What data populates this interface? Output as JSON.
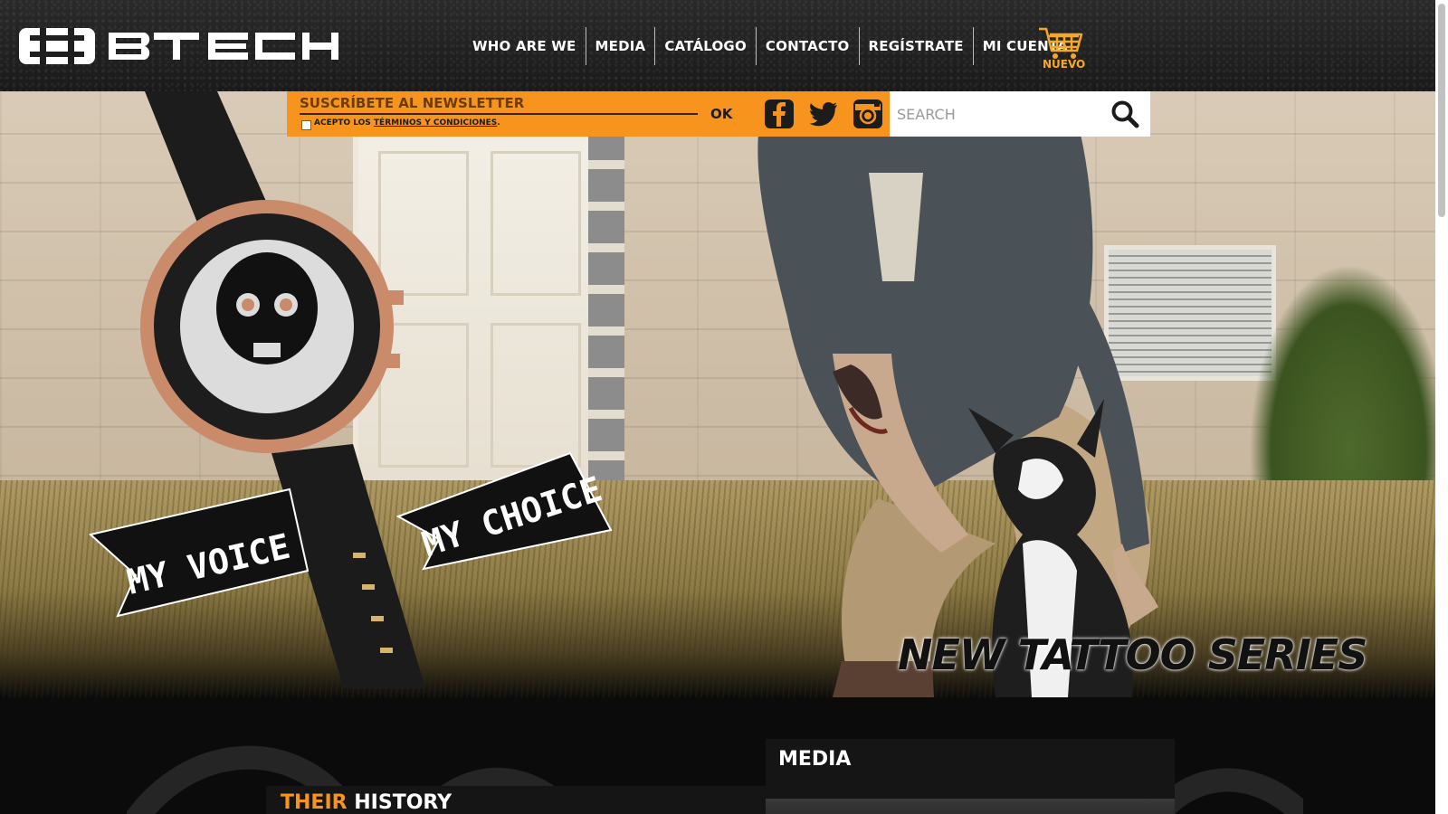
{
  "brand": {
    "name": "BTECH"
  },
  "nav": {
    "items": [
      "WHO ARE WE",
      "MEDIA",
      "CATÁLOGO",
      "CONTACTO",
      "REGÍSTRATE",
      "MI CUENTA"
    ],
    "cart_badge": "NUEVO"
  },
  "newsletter": {
    "placeholder": "SUSCRÍBETE AL NEWSLETTER",
    "accept_prefix": "ACEPTO LOS ",
    "terms_link": "TÉRMINOS Y CONDICIONES",
    "accept_suffix": ".",
    "submit_label": "OK"
  },
  "social": {
    "icons": [
      "facebook-icon",
      "twitter-icon",
      "instagram-icon"
    ]
  },
  "search": {
    "placeholder": "SEARCH",
    "value": ""
  },
  "hero": {
    "banner_left": "MY VOICE",
    "banner_right": "MY CHOICE",
    "tagline": "NEW TATTOO SERIES"
  },
  "sections": {
    "history_accent": "THEIR",
    "history_rest": "HISTORY",
    "media_title": "MEDIA"
  },
  "colors": {
    "accent": "#f7941d",
    "header_bg": "#1f1f1f",
    "cart": "#f7a823"
  }
}
